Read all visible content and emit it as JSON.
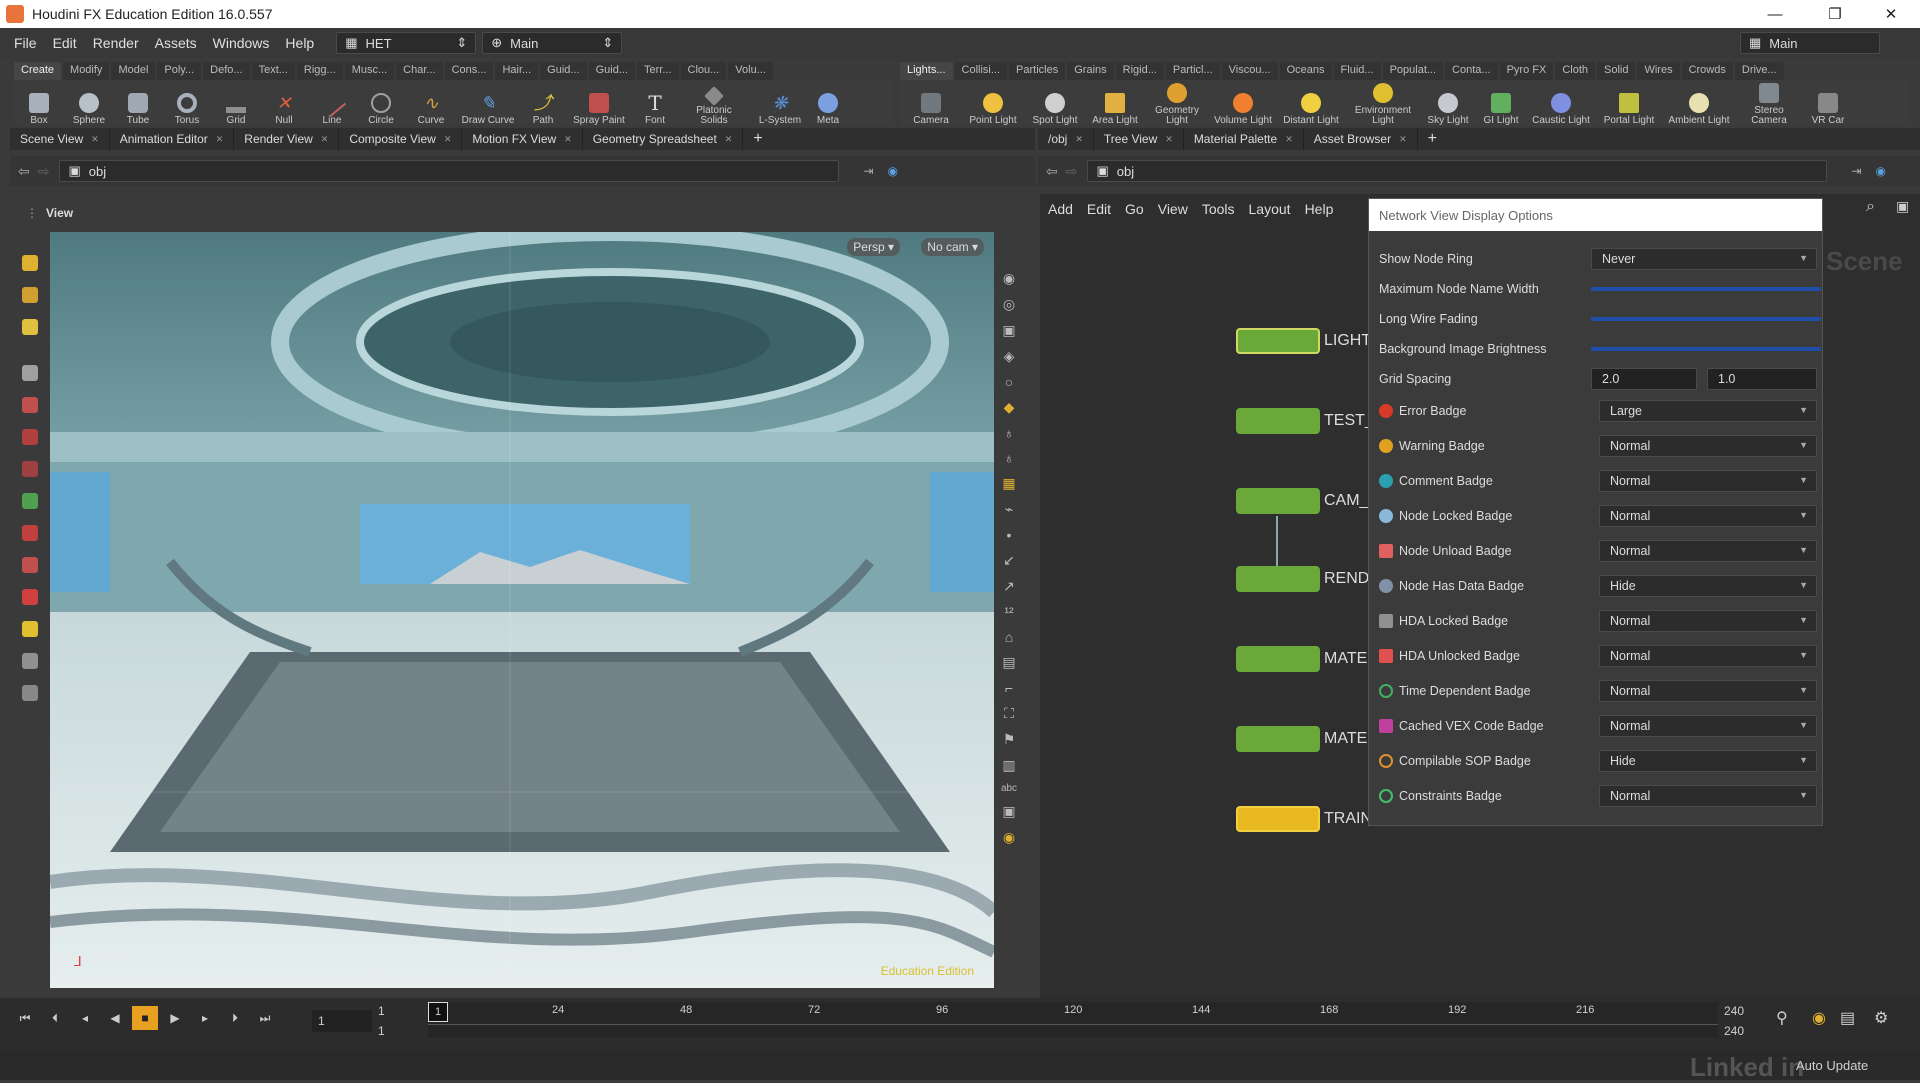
{
  "window": {
    "title": "Houdini FX Education Edition 16.0.557",
    "minimize": "—",
    "maximize": "❐",
    "close": "✕"
  },
  "menubar": {
    "items": [
      "File",
      "Edit",
      "Render",
      "Assets",
      "Windows",
      "Help"
    ],
    "desktop": "HET",
    "desktop_arrow": "⇕",
    "context": "Main",
    "context_arrow": "⇕",
    "right_desktop": "Main"
  },
  "shelf_left": {
    "tabs": [
      "Create",
      "Modify",
      "Model",
      "Poly...",
      "Defo...",
      "Text...",
      "Rigg...",
      "Musc...",
      "Char...",
      "Cons...",
      "Hair...",
      "Guid...",
      "Guid...",
      "Terr...",
      "Clou...",
      "Volu..."
    ],
    "tools": [
      "Box",
      "Sphere",
      "Tube",
      "Torus",
      "Grid",
      "Null",
      "Line",
      "Circle",
      "Curve",
      "Draw Curve",
      "Path",
      "Spray Paint",
      "Font",
      "Platonic Solids",
      "L-System",
      "Meta"
    ]
  },
  "shelf_right": {
    "tabs": [
      "Lights...",
      "Collisi...",
      "Particles",
      "Grains",
      "Rigid...",
      "Particl...",
      "Viscou...",
      "Oceans",
      "Fluid...",
      "Populat...",
      "Conta...",
      "Pyro FX",
      "Cloth",
      "Solid",
      "Wires",
      "Crowds",
      "Drive..."
    ],
    "tools": [
      "Camera",
      "Point Light",
      "Spot Light",
      "Area Light",
      "Geometry Light",
      "Volume Light",
      "Distant Light",
      "Environment Light",
      "Sky Light",
      "GI Light",
      "Caustic Light",
      "Portal Light",
      "Ambient Light",
      "Stereo Camera",
      "VR Car"
    ]
  },
  "left_pane": {
    "tabs": [
      "Scene View",
      "Animation Editor",
      "Render View",
      "Composite View",
      "Motion FX View",
      "Geometry Spreadsheet"
    ],
    "path": "obj",
    "view_label": "View",
    "persp": "Persp ▾",
    "cam": "No cam ▾",
    "watermark": "Education Edition"
  },
  "right_pane": {
    "tabs": [
      "/obj",
      "Tree View",
      "Material Palette",
      "Asset Browser"
    ],
    "path": "obj",
    "menu": [
      "Add",
      "Edit",
      "Go",
      "View",
      "Tools",
      "Layout",
      "Help"
    ],
    "scene_label": "Scene",
    "nodes": [
      "LIGHT",
      "TEST_",
      "CAM_",
      "REND",
      "MATE",
      "MATE",
      "TRAIN"
    ]
  },
  "display_options": {
    "title": "Network View Display Options",
    "show_node_ring": {
      "label": "Show Node Ring",
      "value": "Never"
    },
    "max_node_name_width": "Maximum Node Name Width",
    "long_wire_fading": "Long Wire Fading",
    "bg_image_brightness": "Background Image Brightness",
    "grid_spacing": {
      "label": "Grid Spacing",
      "x": "2.0",
      "y": "1.0"
    },
    "badges": [
      {
        "label": "Error Badge",
        "value": "Large",
        "color": "#d83a2a"
      },
      {
        "label": "Warning Badge",
        "value": "Normal",
        "color": "#e0a020"
      },
      {
        "label": "Comment Badge",
        "value": "Normal",
        "color": "#2aa0b0"
      },
      {
        "label": "Node Locked Badge",
        "value": "Normal",
        "color": "#8ab8d8"
      },
      {
        "label": "Node Unload Badge",
        "value": "Normal",
        "color": "#e06060"
      },
      {
        "label": "Node Has Data Badge",
        "value": "Hide",
        "color": "#8090a8"
      },
      {
        "label": "HDA Locked Badge",
        "value": "Normal",
        "color": "#909090"
      },
      {
        "label": "HDA Unlocked Badge",
        "value": "Normal",
        "color": "#e05050"
      },
      {
        "label": "Time Dependent Badge",
        "value": "Normal",
        "color": "#40b060"
      },
      {
        "label": "Cached VEX Code Badge",
        "value": "Normal",
        "color": "#c040a0"
      },
      {
        "label": "Compilable SOP Badge",
        "value": "Hide",
        "color": "#e09030"
      },
      {
        "label": "Constraints Badge",
        "value": "Normal",
        "color": "#40c070"
      }
    ]
  },
  "timeline": {
    "frame": "1",
    "start": "1",
    "start2": "1",
    "ticks": [
      "1",
      "24",
      "48",
      "72",
      "96",
      "120",
      "144",
      "168",
      "192",
      "216"
    ],
    "end": "240",
    "end2": "240",
    "auto_update": "Auto Update",
    "brand": "Linked in"
  }
}
